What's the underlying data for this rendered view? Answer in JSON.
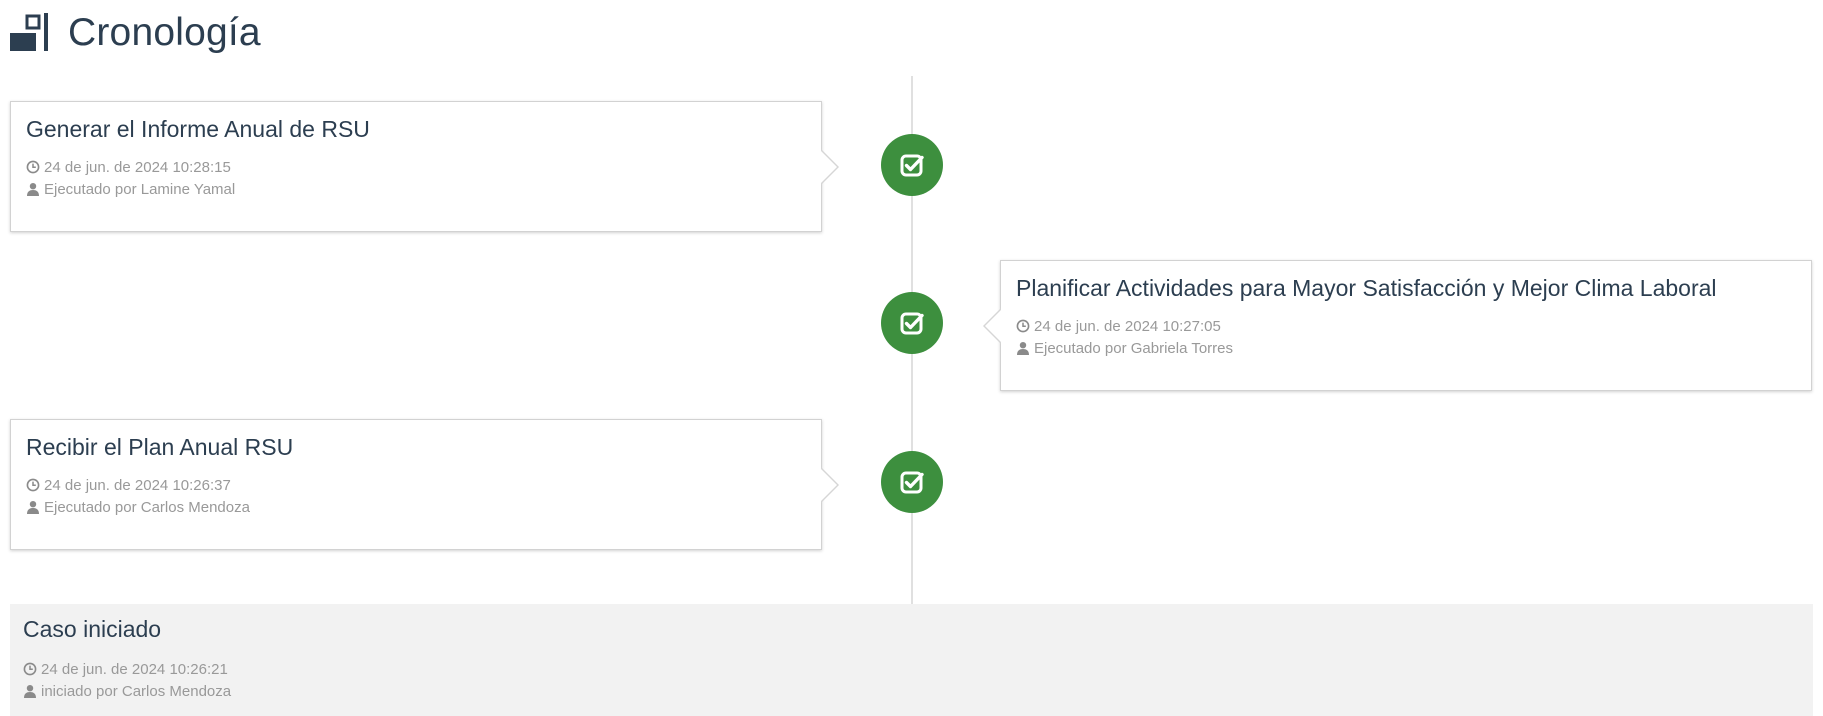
{
  "page": {
    "title": "Cronología",
    "title_icon": "timeline-icon"
  },
  "events": [
    {
      "title": "Generar el Informe Anual de RSU",
      "datetime": "24 de jun. de 2024 10:28:15",
      "executed_by": "Ejecutado por Lamine Yamal",
      "side": "left",
      "status_icon": "check-square-icon"
    },
    {
      "title": "Planificar Actividades para Mayor Satisfacción y Mejor Clima Laboral",
      "datetime": "24 de jun. de 2024 10:27:05",
      "executed_by": "Ejecutado por Gabriela Torres",
      "side": "right",
      "status_icon": "check-square-icon"
    },
    {
      "title": "Recibir el Plan Anual RSU",
      "datetime": "24 de jun. de 2024 10:26:37",
      "executed_by": "Ejecutado por Carlos Mendoza",
      "side": "left",
      "status_icon": "check-square-icon"
    }
  ],
  "case_start": {
    "title": "Caso iniciado",
    "datetime": "24 de jun. de 2024 10:26:21",
    "started_by": "iniciado por Carlos Mendoza"
  },
  "colors": {
    "badge_green": "#3d8f3e",
    "title_text": "#2c3e50",
    "meta_text": "#999999",
    "footer_bg": "#f2f2f2"
  }
}
